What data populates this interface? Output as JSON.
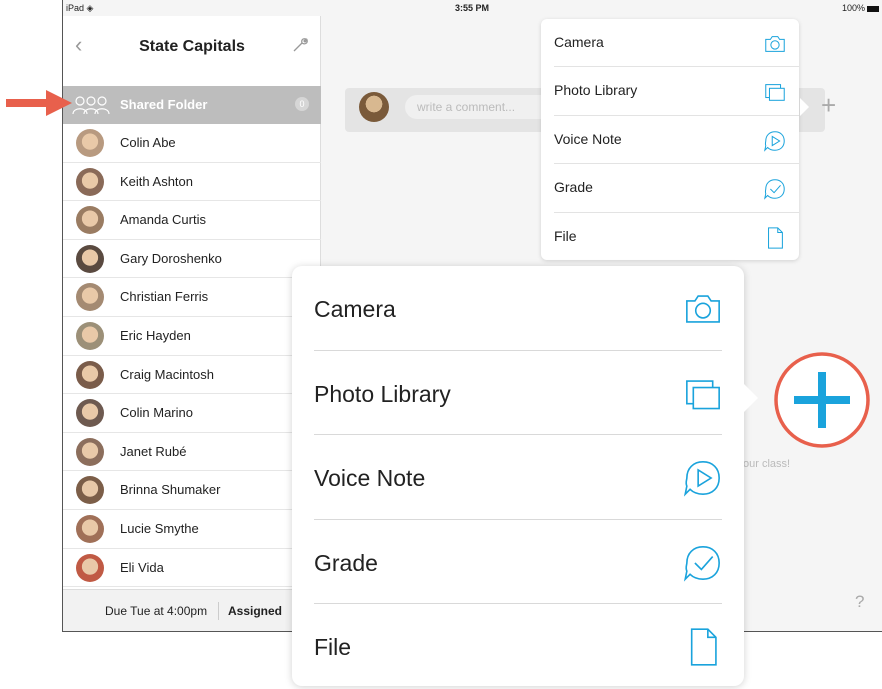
{
  "status_bar": {
    "device": "iPad",
    "wifi_icon": "wifi-icon",
    "time": "3:55 PM",
    "battery": "100%"
  },
  "sidebar": {
    "title": "State Capitals",
    "back_icon": "chevron-left-icon",
    "settings_icon": "wrench-icon",
    "shared_folder": {
      "label": "Shared Folder",
      "count": "0",
      "icon": "group-icon"
    },
    "students": [
      {
        "name": "Colin Abe",
        "color": "#b89a80"
      },
      {
        "name": "Keith Ashton",
        "color": "#8a6a58"
      },
      {
        "name": "Amanda Curtis",
        "color": "#9a7c62"
      },
      {
        "name": "Gary Doroshenko",
        "color": "#5a4a40"
      },
      {
        "name": "Christian Ferris",
        "color": "#a48a72"
      },
      {
        "name": "Eric Hayden",
        "color": "#9c9078"
      },
      {
        "name": "Craig Macintosh",
        "color": "#7a5c4a"
      },
      {
        "name": "Colin Marino",
        "color": "#6e5a50"
      },
      {
        "name": "Janet Rubé",
        "color": "#8c6e5c"
      },
      {
        "name": "Brinna Shumaker",
        "color": "#7c5e48"
      },
      {
        "name": "Lucie Smythe",
        "color": "#a07058"
      },
      {
        "name": "Eli Vida",
        "color": "#c05a44"
      }
    ],
    "footer": {
      "due": "Due Tue at 4:00pm",
      "status": "Assigned"
    }
  },
  "main": {
    "comment_placeholder": "write a comment...",
    "add_icon": "plus-icon",
    "empty_text": "our class!",
    "help_icon": "?"
  },
  "small_menu": [
    {
      "label": "Camera",
      "icon": "camera-icon"
    },
    {
      "label": "Photo Library",
      "icon": "photo-library-icon"
    },
    {
      "label": "Voice Note",
      "icon": "voice-note-icon"
    },
    {
      "label": "Grade",
      "icon": "grade-icon"
    },
    {
      "label": "File",
      "icon": "file-icon"
    }
  ],
  "big_menu": [
    {
      "label": "Camera",
      "icon": "camera-icon"
    },
    {
      "label": "Photo Library",
      "icon": "photo-library-icon"
    },
    {
      "label": "Voice Note",
      "icon": "voice-note-icon"
    },
    {
      "label": "Grade",
      "icon": "grade-icon"
    },
    {
      "label": "File",
      "icon": "file-icon"
    }
  ],
  "colors": {
    "accent_blue": "#1aa3dc",
    "annotation_red": "#e8604c",
    "shared_row": "#bdbdbd"
  }
}
